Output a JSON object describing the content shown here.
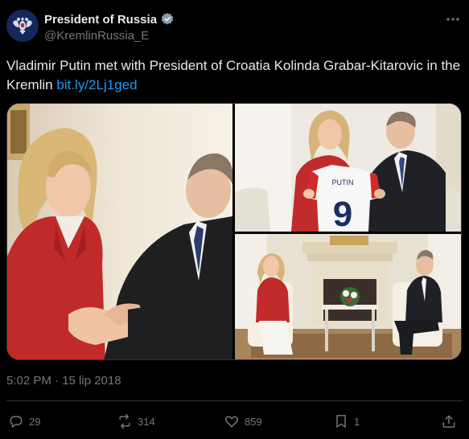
{
  "account": {
    "display_name": "President of Russia",
    "handle": "@KremlinRussia_E",
    "verified_icon": "verified-badge-icon",
    "avatar_icon": "russian-coat-of-arms-icon"
  },
  "more_icon": "more-options-icon",
  "tweet": {
    "text": "Vladimir Putin met with President of Croatia Kolinda Grabar-Kitarovic in the Kremlin ",
    "link_text": "bit.ly/2Lj1ged"
  },
  "media": {
    "photos": [
      "handshake-photo",
      "jersey-photo",
      "meeting-room-photo"
    ],
    "jersey_text": "PUTIN",
    "jersey_number": "9"
  },
  "timestamp": "5:02 PM · 15 lip 2018",
  "actions": {
    "replies": "29",
    "reposts": "314",
    "likes": "859",
    "bookmarks": "1"
  },
  "colors": {
    "background": "#000000",
    "text": "#e7e9ea",
    "secondary": "#71767b",
    "link": "#1d9bf0",
    "border": "#2f3336"
  }
}
